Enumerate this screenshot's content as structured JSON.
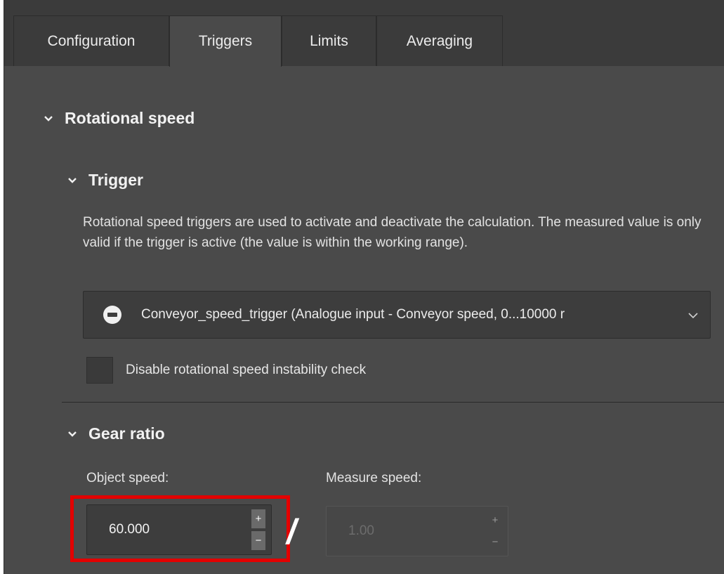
{
  "tabs": [
    {
      "label": "Configuration",
      "active": false
    },
    {
      "label": "Triggers",
      "active": true
    },
    {
      "label": "Limits",
      "active": false
    },
    {
      "label": "Averaging",
      "active": false
    }
  ],
  "sections": {
    "rotational_speed": "Rotational speed",
    "trigger": "Trigger",
    "gear_ratio": "Gear ratio"
  },
  "trigger": {
    "description": "Rotational speed triggers are used to activate and deactivate the calculation. The measured value is only valid if the trigger is active (the value is within the working range).",
    "selected": "Conveyor_speed_trigger (Analogue input - Conveyor speed, 0...10000 r",
    "selected_icon": "trigger-icon",
    "instability_check_label": "Disable rotational speed instability check",
    "instability_check_checked": false
  },
  "gear_ratio": {
    "object_speed_label": "Object speed:",
    "object_speed_value": "60.000",
    "measure_speed_label": "Measure speed:",
    "measure_speed_value": "1.00",
    "divider_symbol": "/",
    "increment_symbol": "+",
    "decrement_symbol": "−"
  },
  "colors": {
    "panel": "#4a4a4a",
    "tabbar": "#3b3b3b",
    "highlight": "#e30000"
  }
}
